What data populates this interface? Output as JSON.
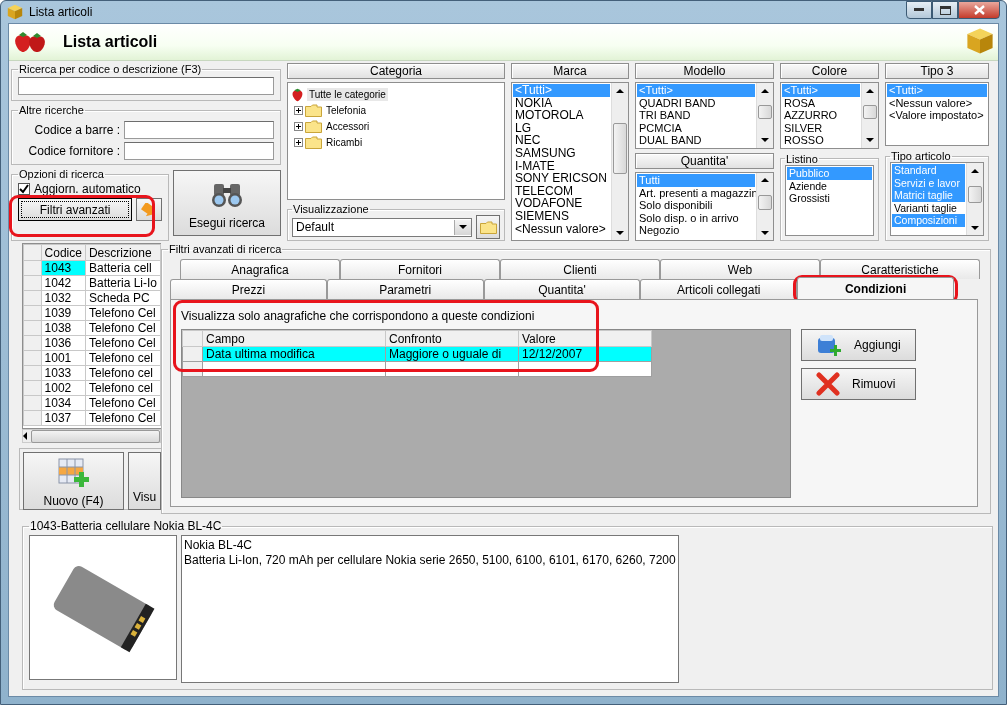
{
  "window": {
    "title": "Lista articoli"
  },
  "header": {
    "title": "Lista articoli"
  },
  "search": {
    "label": "Ricerca per codice o descrizione (F3)"
  },
  "other_searches": {
    "label": "Altre ricerche",
    "fields": [
      {
        "label": "Codice a barre :"
      },
      {
        "label": "Codice fornitore :"
      }
    ]
  },
  "options": {
    "label": "Opzioni di ricerca",
    "auto_update": {
      "label": "Aggiorn. automatico",
      "checked": true
    },
    "advanced_button": "Filtri avanzati"
  },
  "run_button": "Esegui ricerca",
  "category": {
    "header": "Categoria",
    "tree": [
      {
        "label": "Tutte le categorie",
        "kind": "root",
        "selected": true,
        "children": [
          {
            "label": "Telefonia",
            "kind": "folder",
            "selected": false,
            "expanded": false
          },
          {
            "label": "Accessori",
            "kind": "folder",
            "selected": false,
            "expanded": false
          },
          {
            "label": "Ricambi",
            "kind": "folder",
            "selected": false,
            "expanded": false
          }
        ]
      }
    ]
  },
  "view": {
    "label": "Visualizzazione",
    "value": "Default"
  },
  "filter_columns": [
    {
      "lists": [
        {
          "title": "Marca",
          "kind": "header",
          "scrollable": true,
          "items": [
            {
              "text": "<Tutti>",
              "selected": true
            },
            {
              "text": "NOKIA",
              "selected": false
            },
            {
              "text": "MOTOROLA",
              "selected": false
            },
            {
              "text": "LG",
              "selected": false
            },
            {
              "text": "NEC",
              "selected": false
            },
            {
              "text": "SAMSUNG",
              "selected": false
            },
            {
              "text": "I-MATE",
              "selected": false
            },
            {
              "text": "SONY ERICSON",
              "selected": false
            },
            {
              "text": "TELECOM",
              "selected": false
            },
            {
              "text": "VODAFONE",
              "selected": false
            },
            {
              "text": "SIEMENS",
              "selected": false
            },
            {
              "text": "<Nessun valore>",
              "selected": false
            }
          ]
        }
      ]
    },
    {
      "lists": [
        {
          "title": "Modello",
          "kind": "header",
          "scrollable": true,
          "items": [
            {
              "text": "<Tutti>",
              "selected": true
            },
            {
              "text": "QUADRI BAND",
              "selected": false
            },
            {
              "text": "TRI BAND",
              "selected": false
            },
            {
              "text": "PCMCIA",
              "selected": false
            },
            {
              "text": "DUAL BAND",
              "selected": false
            }
          ]
        },
        {
          "title": "Quantita'",
          "kind": "header",
          "scrollable": true,
          "items": [
            {
              "text": "Tutti",
              "selected": true
            },
            {
              "text": "Art. presenti a magazzin",
              "selected": false
            },
            {
              "text": "Solo disponibili",
              "selected": false
            },
            {
              "text": "Solo disp. o in arrivo",
              "selected": false
            },
            {
              "text": "Negozio",
              "selected": false
            }
          ]
        }
      ]
    },
    {
      "lists": [
        {
          "title": "Colore",
          "kind": "header",
          "scrollable": true,
          "items": [
            {
              "text": "<Tutti>",
              "selected": true
            },
            {
              "text": "ROSA",
              "selected": false
            },
            {
              "text": "AZZURRO",
              "selected": false
            },
            {
              "text": "SILVER",
              "selected": false
            },
            {
              "text": "ROSSO",
              "selected": false
            }
          ]
        },
        {
          "title": "Listino",
          "kind": "group",
          "scrollable": false,
          "items": [
            {
              "text": "Pubblico",
              "selected": true
            },
            {
              "text": "Aziende",
              "selected": false
            },
            {
              "text": "Grossisti",
              "selected": false
            }
          ]
        }
      ]
    },
    {
      "lists": [
        {
          "title": "Tipo 3",
          "kind": "header",
          "scrollable": false,
          "items": [
            {
              "text": "<Tutti>",
              "selected": true
            },
            {
              "text": "<Nessun valore>",
              "selected": false
            },
            {
              "text": "<Valore impostato>",
              "selected": false
            }
          ]
        },
        {
          "title": "Tipo articolo",
          "kind": "group",
          "scrollable": true,
          "items": [
            {
              "text": "Standard",
              "selected": true
            },
            {
              "text": "Servizi e lavor",
              "selected": true
            },
            {
              "text": "Matrici taglie",
              "selected": true
            },
            {
              "text": "Varianti taglie",
              "selected": false
            },
            {
              "text": "Composizioni",
              "selected": true
            }
          ]
        }
      ]
    }
  ],
  "articles": {
    "columns": [
      "Codice",
      "Descrizione"
    ],
    "rows": [
      {
        "cells": [
          "1043",
          "Batteria cell"
        ],
        "selected": true
      },
      {
        "cells": [
          "1042",
          "Batteria Li-Io"
        ],
        "selected": false
      },
      {
        "cells": [
          "1032",
          "Scheda PC"
        ],
        "selected": false
      },
      {
        "cells": [
          "1039",
          "Telefono Cel"
        ],
        "selected": false
      },
      {
        "cells": [
          "1038",
          "Telefono Cel"
        ],
        "selected": false
      },
      {
        "cells": [
          "1036",
          "Telefono Cel"
        ],
        "selected": false
      },
      {
        "cells": [
          "1001",
          "Telefono cel"
        ],
        "selected": false
      },
      {
        "cells": [
          "1033",
          "Telefono cel"
        ],
        "selected": false
      },
      {
        "cells": [
          "1002",
          "Telefono cel"
        ],
        "selected": false
      },
      {
        "cells": [
          "1034",
          "Telefono Cel"
        ],
        "selected": false
      },
      {
        "cells": [
          "1037",
          "Telefono Cel"
        ],
        "selected": false
      }
    ]
  },
  "actions": [
    {
      "label": "Nuovo (F4)"
    },
    {
      "label": "Visu"
    }
  ],
  "advanced": {
    "title": "Filtri avanzati di ricerca",
    "tab_rows": [
      [
        {
          "label": "Anagrafica",
          "selected": false
        },
        {
          "label": "Fornitori",
          "selected": false
        },
        {
          "label": "Clienti",
          "selected": false
        },
        {
          "label": "Web",
          "selected": false
        },
        {
          "label": "Caratteristiche",
          "selected": false
        }
      ],
      [
        {
          "label": "Prezzi",
          "selected": false
        },
        {
          "label": "Parametri",
          "selected": false
        },
        {
          "label": "Quantita'",
          "selected": false
        },
        {
          "label": "Articoli collegati",
          "selected": false
        },
        {
          "label": "Condizioni",
          "selected": true
        }
      ]
    ],
    "hint": "Visualizza solo anagrafiche che corrispondono a queste condizioni",
    "grid": {
      "columns": [
        "Campo",
        "Confronto",
        "Valore"
      ],
      "rows": [
        {
          "cells": [
            "Data ultima modifica",
            "Maggiore o uguale di",
            "12/12/2007"
          ],
          "selected": true
        }
      ]
    },
    "buttons": [
      {
        "label": "Aggiungi",
        "kind": "add"
      },
      {
        "label": "Rimuovi",
        "kind": "remove"
      }
    ]
  },
  "detail": {
    "title": "1043-Batteria cellulare Nokia BL-4C",
    "lines": [
      "Nokia BL-4C",
      "Batteria Li-Ion, 720 mAh per cellulare Nokia serie 2650, 5100, 6100, 6101, 6170, 6260, 7200"
    ]
  }
}
